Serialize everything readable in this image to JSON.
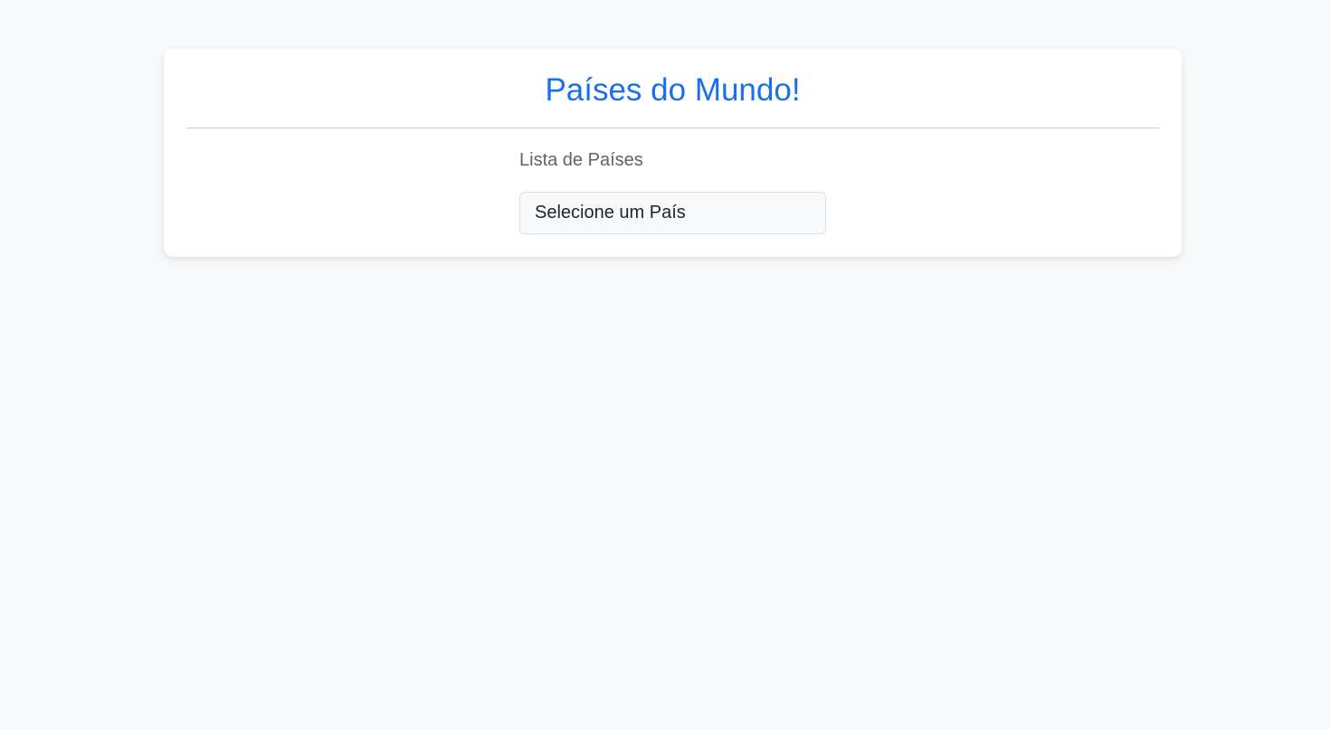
{
  "page": {
    "title": "Países do Mundo!"
  },
  "country_list": {
    "label": "Lista de Países",
    "selected_value": "Selecione um País"
  },
  "colors": {
    "background": "#f8f9fa",
    "title_accent": "#1a6ef0",
    "label_text": "#5e6367",
    "select_text": "#212529"
  }
}
